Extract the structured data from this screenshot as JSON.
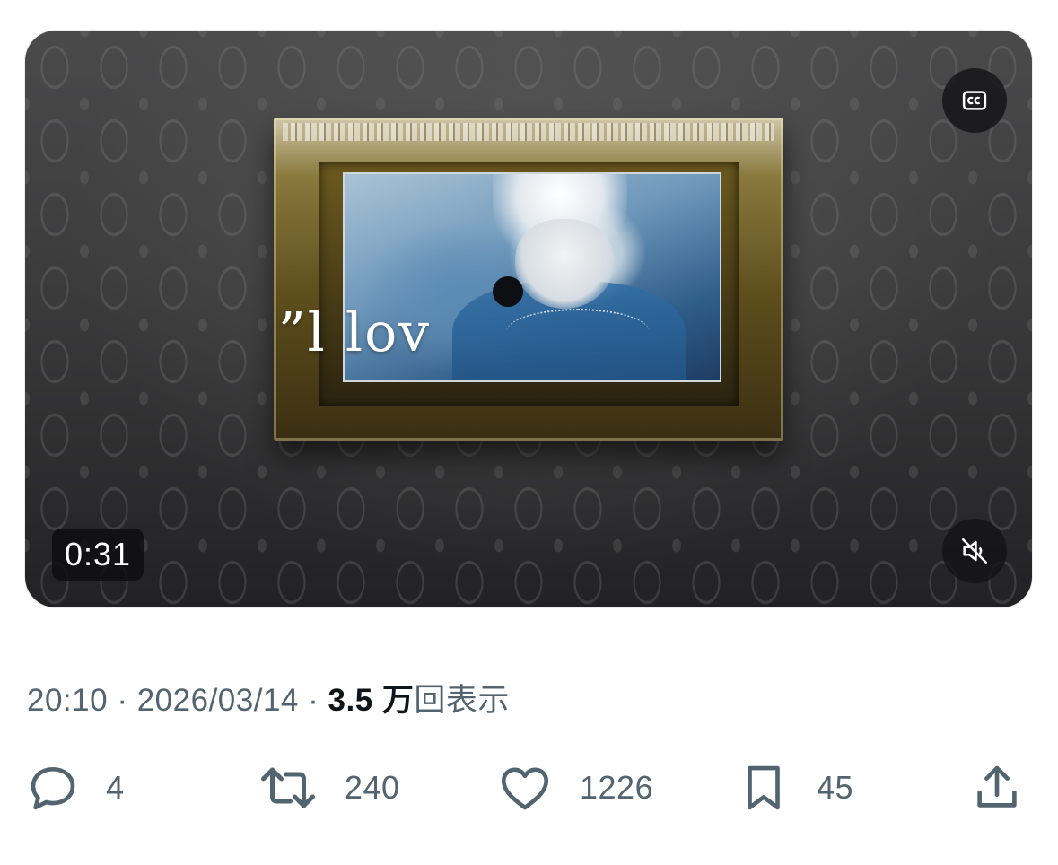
{
  "video": {
    "overlay_text": "”l lov",
    "duration": "0:31",
    "cc_icon": "closed-captions-icon",
    "mute_icon": "speaker-muted-icon"
  },
  "meta": {
    "time": "20:10",
    "separator": "·",
    "date": "2026/03/14",
    "views_count": "3.5 万",
    "views_label": "回表示"
  },
  "actions": {
    "reply": {
      "icon": "reply-bubble-icon",
      "count": "4"
    },
    "repost": {
      "icon": "repost-icon",
      "count": "240"
    },
    "like": {
      "icon": "heart-icon",
      "count": "1226"
    },
    "bookmark": {
      "icon": "bookmark-icon",
      "count": "45"
    },
    "share": {
      "icon": "share-upload-icon"
    }
  },
  "colors": {
    "secondary_text": "#536471",
    "primary_text": "#0f1419",
    "video_button_bg": "#141416"
  }
}
